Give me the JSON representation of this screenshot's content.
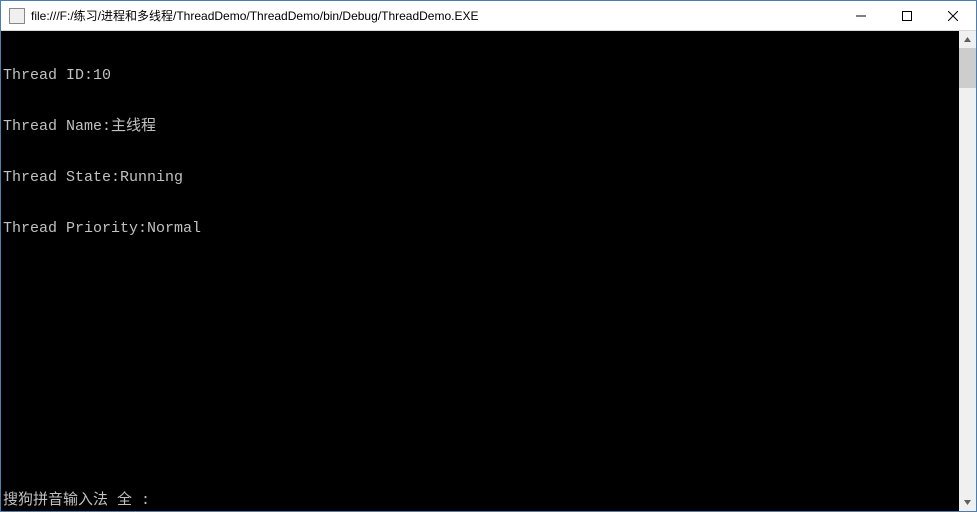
{
  "window": {
    "title": "file:///F:/练习/进程和多线程/ThreadDemo/ThreadDemo/bin/Debug/ThreadDemo.EXE"
  },
  "console": {
    "lines": [
      "Thread ID:10",
      "Thread Name:主线程",
      "Thread State:Running",
      "Thread Priority:Normal"
    ],
    "ime_status": "搜狗拼音输入法 全 :"
  }
}
